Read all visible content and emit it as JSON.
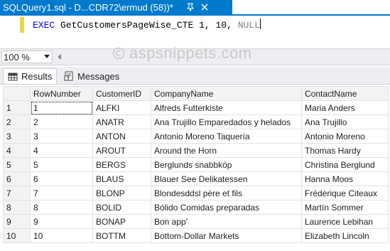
{
  "document_tab": {
    "title": "SQLQuery1.sql - D...CDR72\\ermud (58))*",
    "pin_icon": "pin-icon",
    "close_icon": "close-icon"
  },
  "editor": {
    "exec_keyword": "EXEC",
    "procedure": "GetCustomersPageWise_CTE",
    "args": "1, 10,",
    "null_keyword": "NULL"
  },
  "zoom": {
    "value": "100 %"
  },
  "watermark": {
    "text": "aspsnippets.com"
  },
  "results_tabs": [
    {
      "label": "Results",
      "icon": "grid-icon"
    },
    {
      "label": "Messages",
      "icon": "messages-icon"
    }
  ],
  "grid": {
    "columns": [
      "RowNumber",
      "CustomerID",
      "CompanyName",
      "ContactName"
    ],
    "rows": [
      {
        "n": "1",
        "RowNumber": "1",
        "CustomerID": "ALFKI",
        "CompanyName": "Alfreds Futterkiste",
        "ContactName": "Maria Anders"
      },
      {
        "n": "2",
        "RowNumber": "2",
        "CustomerID": "ANATR",
        "CompanyName": "Ana Trujillo Emparedados y helados",
        "ContactName": "Ana Trujillo"
      },
      {
        "n": "3",
        "RowNumber": "3",
        "CustomerID": "ANTON",
        "CompanyName": "Antonio Moreno Taquería",
        "ContactName": "Antonio Moreno"
      },
      {
        "n": "4",
        "RowNumber": "4",
        "CustomerID": "AROUT",
        "CompanyName": "Around the Horn",
        "ContactName": "Thomas Hardy"
      },
      {
        "n": "5",
        "RowNumber": "5",
        "CustomerID": "BERGS",
        "CompanyName": "Berglunds snabbköp",
        "ContactName": "Christina Berglund"
      },
      {
        "n": "6",
        "RowNumber": "6",
        "CustomerID": "BLAUS",
        "CompanyName": "Blauer See Delikatessen",
        "ContactName": "Hanna Moos"
      },
      {
        "n": "7",
        "RowNumber": "7",
        "CustomerID": "BLONP",
        "CompanyName": "Blondesddsl père et fils",
        "ContactName": "Frédérique Citeaux"
      },
      {
        "n": "8",
        "RowNumber": "8",
        "CustomerID": "BOLID",
        "CompanyName": "Bólido Comidas preparadas",
        "ContactName": "Martín Sommer"
      },
      {
        "n": "9",
        "RowNumber": "9",
        "CustomerID": "BONAP",
        "CompanyName": "Bon app'",
        "ContactName": "Laurence Lebihan"
      },
      {
        "n": "10",
        "RowNumber": "10",
        "CustomerID": "BOTTM",
        "CompanyName": "Bottom-Dollar Markets",
        "ContactName": "Elizabeth Lincoln"
      }
    ]
  },
  "colors": {
    "accent": "#007acc",
    "keyword": "#0000ff",
    "null": "#808080"
  }
}
